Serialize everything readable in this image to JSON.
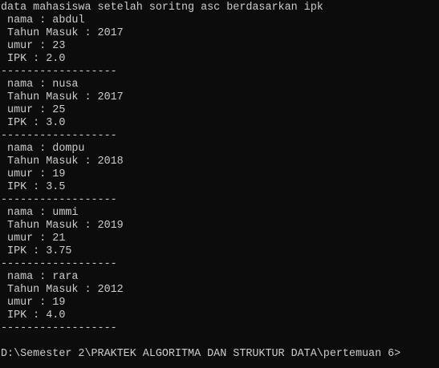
{
  "console": {
    "header": "data mahasiswa setelah soritng asc berdasarkan ipk",
    "separator": "------------------",
    "records": [
      {
        "nama": " nama : abdul",
        "tahun": " Tahun Masuk : 2017",
        "umur": " umur : 23",
        "ipk": " IPK : 2.0"
      },
      {
        "nama": " nama : nusa",
        "tahun": " Tahun Masuk : 2017",
        "umur": " umur : 25",
        "ipk": " IPK : 3.0"
      },
      {
        "nama": " nama : dompu",
        "tahun": " Tahun Masuk : 2018",
        "umur": " umur : 19",
        "ipk": " IPK : 3.5"
      },
      {
        "nama": " nama : ummi",
        "tahun": " Tahun Masuk : 2019",
        "umur": " umur : 21",
        "ipk": " IPK : 3.75"
      },
      {
        "nama": " nama : rara",
        "tahun": " Tahun Masuk : 2012",
        "umur": " umur : 19",
        "ipk": " IPK : 4.0"
      }
    ],
    "prompt": "D:\\Semester 2\\PRAKTEK ALGORITMA DAN STRUKTUR DATA\\pertemuan 6>"
  },
  "colors": {
    "background": "#0c0c0c",
    "text": "#cccccc"
  }
}
